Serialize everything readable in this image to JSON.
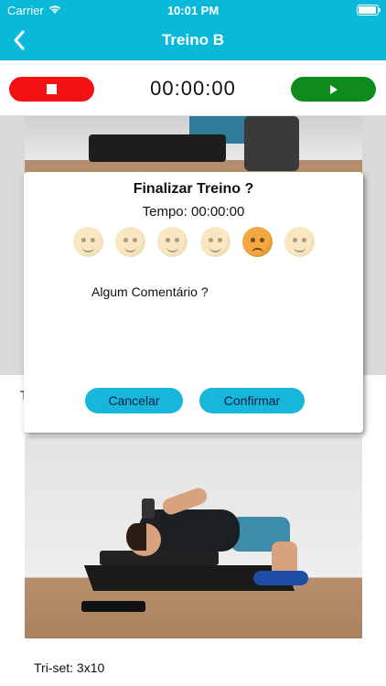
{
  "status_bar": {
    "carrier": "Carrier",
    "time": "10:01 PM"
  },
  "nav": {
    "title": "Treino B",
    "back_icon": "chevron-left-icon"
  },
  "timer": {
    "display": "00:00:00",
    "stop_icon": "stop-icon",
    "play_icon": "play-icon",
    "stop_color": "#f41111",
    "play_color": "#0f8a1c"
  },
  "dialog": {
    "title": "Finalizar Treino ?",
    "time_text": "Tempo: 00:00:00",
    "moods": [
      {
        "icon": "mood-emoji-1-icon"
      },
      {
        "icon": "mood-emoji-2-icon"
      },
      {
        "icon": "mood-emoji-3-icon"
      },
      {
        "icon": "mood-emoji-4-icon"
      },
      {
        "icon": "mood-emoji-5-icon",
        "selected": true
      },
      {
        "icon": "mood-emoji-6-icon"
      }
    ],
    "comment_label": "Algum Comentário ?",
    "cancel_label": "Cancelar",
    "confirm_label": "Confirmar"
  },
  "exercise": {
    "partial_left_text": "T",
    "sets_text": "Tri-set: 3x10"
  },
  "colors": {
    "accent": "#09b9d9",
    "dialog_button": "#17b7dc"
  }
}
